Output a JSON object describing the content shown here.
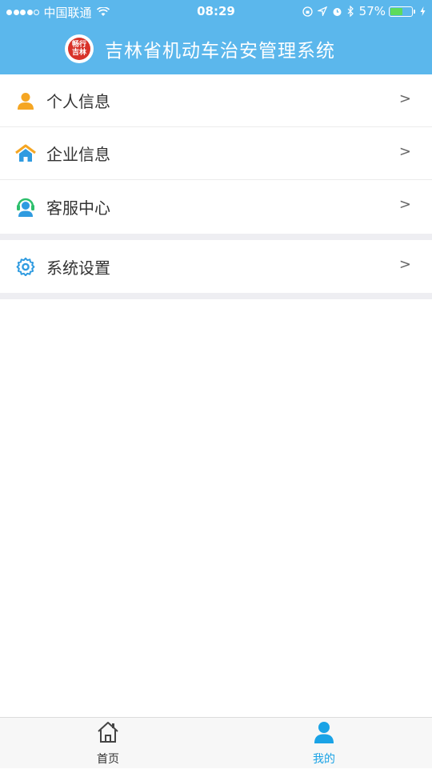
{
  "status_bar": {
    "carrier": "中国联通",
    "time": "08:29",
    "battery": "57%",
    "battery_level": 0.57
  },
  "header": {
    "logo_text": "畅行 吉林",
    "title": "吉林省机动车治安管理系统"
  },
  "menu": {
    "group1": [
      {
        "label": "个人信息",
        "icon": "person-icon",
        "arrow": ">"
      },
      {
        "label": "企业信息",
        "icon": "home-icon",
        "arrow": ">"
      },
      {
        "label": "客服中心",
        "icon": "headset-icon",
        "arrow": ">"
      }
    ],
    "group2": [
      {
        "label": "系统设置",
        "icon": "gear-icon",
        "arrow": ">"
      }
    ]
  },
  "tabs": [
    {
      "label": "首页",
      "icon": "home-outline-icon"
    },
    {
      "label": "我的",
      "icon": "user-icon"
    }
  ],
  "colors": {
    "primary": "#5bb7ec",
    "accent": "#1aa3e6",
    "orange": "#f5a623"
  }
}
